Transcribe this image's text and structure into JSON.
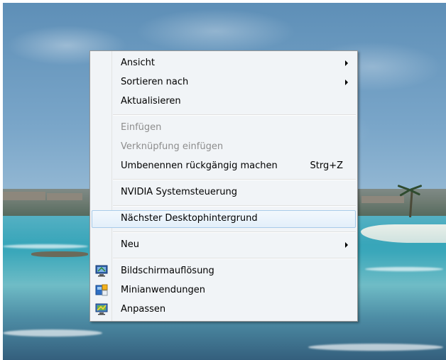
{
  "context_menu": {
    "items": [
      {
        "label": "Ansicht",
        "submenu": true
      },
      {
        "label": "Sortieren nach",
        "submenu": true
      },
      {
        "label": "Aktualisieren"
      },
      {
        "label": "Einfügen",
        "disabled": true
      },
      {
        "label": "Verknüpfung einfügen",
        "disabled": true
      },
      {
        "label": "Umbenennen rückgängig machen",
        "shortcut": "Strg+Z"
      },
      {
        "label": "NVIDIA Systemsteuerung"
      },
      {
        "label": "Nächster Desktophintergrund",
        "highlighted": true
      },
      {
        "label": "Neu",
        "submenu": true
      },
      {
        "label": "Bildschirmauflösung",
        "icon": "display-icon"
      },
      {
        "label": "Minianwendungen",
        "icon": "gadgets-icon"
      },
      {
        "label": "Anpassen",
        "icon": "personalize-icon"
      }
    ]
  },
  "colors": {
    "menu_background": "#f1f4f7",
    "highlight_border": "#a8cbe9",
    "disabled_text": "#8d8d8d"
  }
}
